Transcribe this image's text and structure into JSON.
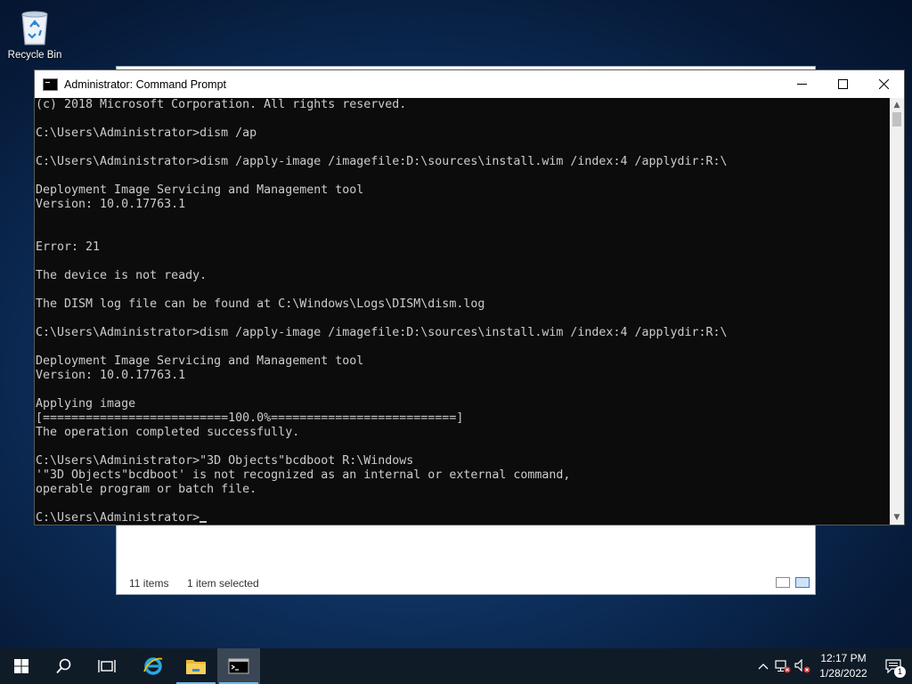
{
  "desktop": {
    "recycle_bin_label": "Recycle Bin"
  },
  "explorer": {
    "status_items": "11 items",
    "status_selected": "1 item selected"
  },
  "cmd": {
    "title": "Administrator: Command Prompt",
    "lines": [
      "(c) 2018 Microsoft Corporation. All rights reserved.",
      "",
      "C:\\Users\\Administrator>dism /ap",
      "",
      "C:\\Users\\Administrator>dism /apply-image /imagefile:D:\\sources\\install.wim /index:4 /applydir:R:\\",
      "",
      "Deployment Image Servicing and Management tool",
      "Version: 10.0.17763.1",
      "",
      "",
      "Error: 21",
      "",
      "The device is not ready.",
      "",
      "The DISM log file can be found at C:\\Windows\\Logs\\DISM\\dism.log",
      "",
      "C:\\Users\\Administrator>dism /apply-image /imagefile:D:\\sources\\install.wim /index:4 /applydir:R:\\",
      "",
      "Deployment Image Servicing and Management tool",
      "Version: 10.0.17763.1",
      "",
      "Applying image",
      "[==========================100.0%==========================]",
      "The operation completed successfully.",
      "",
      "C:\\Users\\Administrator>\"3D Objects\"bcdboot R:\\Windows",
      "'\"3D Objects\"bcdboot' is not recognized as an internal or external command,",
      "operable program or batch file.",
      ""
    ],
    "prompt": "C:\\Users\\Administrator>"
  },
  "taskbar": {
    "time": "12:17 PM",
    "date": "1/28/2022",
    "notification_count": "1"
  },
  "colors": {
    "console_bg": "#0c0c0c",
    "console_fg": "#cccccc",
    "taskbar_bg": "#101b28",
    "accent": "#76b9ed"
  },
  "icons": [
    "recycle-bin-icon",
    "cmd-icon",
    "minimize-icon",
    "maximize-icon",
    "close-icon",
    "windows-start-icon",
    "search-icon",
    "task-view-icon",
    "internet-explorer-icon",
    "file-explorer-icon",
    "chevron-up-icon",
    "network-icon",
    "volume-icon",
    "notification-icon",
    "details-view-icon",
    "large-icons-view-icon"
  ]
}
